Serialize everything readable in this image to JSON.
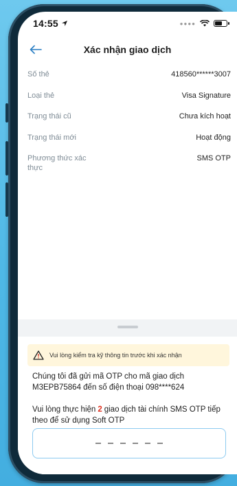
{
  "status_bar": {
    "time": "14:55"
  },
  "nav": {
    "title": "Xác nhận giao dịch"
  },
  "info_rows": [
    {
      "label": "Số thẻ",
      "value": "418560******3007"
    },
    {
      "label": "Loại thẻ",
      "value": "Visa Signature"
    },
    {
      "label": "Trạng thái cũ",
      "value": "Chưa kích hoạt"
    },
    {
      "label": "Trạng thái mới",
      "value": "Hoạt động"
    },
    {
      "label": "Phương thức xác thực",
      "value": "SMS OTP"
    }
  ],
  "sheet": {
    "warning": "Vui lòng kiểm tra kỹ thông tin trước khi xác nhận",
    "otp_message": "Chúng tôi đã gửi mã OTP cho mã giao dịch M3EPB75864 đến số điện thoại 098****624",
    "tx_prefix": "Vui lòng thực hiện",
    "tx_count": "2",
    "tx_suffix": "giao dịch tài chính SMS OTP tiếp theo để sử dụng Soft OTP",
    "otp_length": 6
  },
  "colors": {
    "accent": "#2a7fc4",
    "warning_bg": "#fff6dc",
    "highlight": "#e0301e"
  }
}
